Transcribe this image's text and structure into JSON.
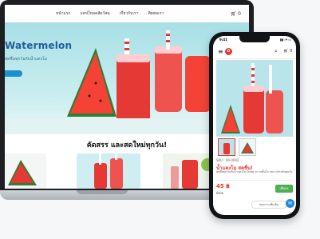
{
  "nav": {
    "links": [
      "หน้าแรก",
      "แคปใหลดสัดวัสดุ",
      "เกี่ยวกับเรา",
      "ติดต่อเรา"
    ],
    "cart": "0"
  },
  "hero": {
    "title": "Watermelon",
    "subtitle": "สดชื่นทุกวันกับน้ำแตงโม"
  },
  "section": {
    "title": "คัดสรร และสดใหม่ทุกวัน!"
  },
  "phone": {
    "time": "9:41",
    "status_icons": "▮▮ ◔ ▭",
    "cart": "0",
    "sku": "SKU : 00-0002",
    "product_name": "น้ำแตงโม สดชื่น!",
    "product_desc": "สดชื่นทุกวันกับน้ำแตงโม ปั่นสด หวานชื่นใจ เหมาะสำหรับทุกวัน",
    "price": "45 ฿",
    "old_price": "60 ฿",
    "add_cart": "เพิ่มลง",
    "chat_text": "สอบถามเพิ่มเติม"
  },
  "colors": {
    "accent": "#e53935",
    "brand_blue": "#1e5e9e",
    "cta_green": "#4caf50"
  },
  "icons": [
    "menu-icon",
    "logo-icon",
    "search-icon",
    "cart-icon",
    "chat-icon"
  ]
}
